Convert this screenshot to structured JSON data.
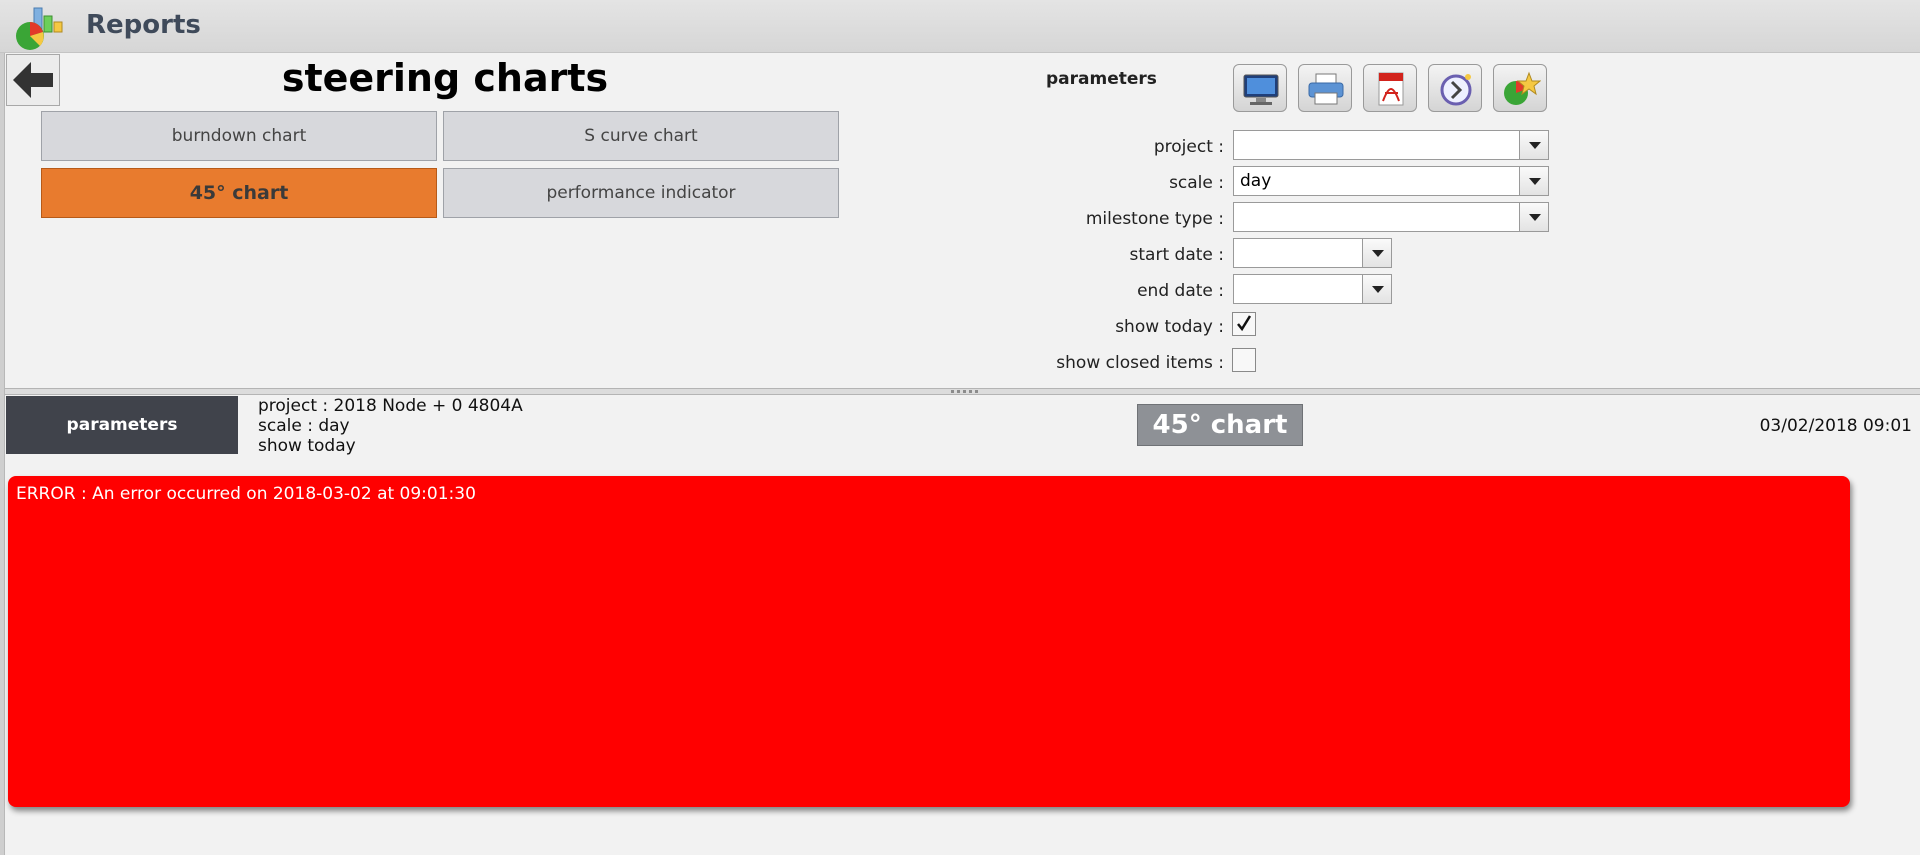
{
  "app": {
    "title": "Reports",
    "logo_icon": "reports-chart-icon"
  },
  "page": {
    "title": "steering charts",
    "back_icon": "back-arrow-icon"
  },
  "chart_buttons": [
    {
      "label": "burndown chart",
      "active": false
    },
    {
      "label": "S curve chart",
      "active": false
    },
    {
      "label": "45° chart",
      "active": true
    },
    {
      "label": "performance indicator",
      "active": false
    }
  ],
  "parameters": {
    "heading": "parameters",
    "toolbar": [
      {
        "name": "display-icon",
        "tooltip": "display"
      },
      {
        "name": "print-icon",
        "tooltip": "print"
      },
      {
        "name": "pdf-icon",
        "tooltip": "pdf"
      },
      {
        "name": "history-icon",
        "tooltip": "history"
      },
      {
        "name": "favorite-report-icon",
        "tooltip": "favorite"
      }
    ],
    "fields": {
      "project": {
        "label": "project :",
        "value": ""
      },
      "scale": {
        "label": "scale :",
        "value": "day"
      },
      "milestone_type": {
        "label": "milestone type :",
        "value": ""
      },
      "start_date": {
        "label": "start date :",
        "value": ""
      },
      "end_date": {
        "label": "end date :",
        "value": ""
      },
      "show_today": {
        "label": "show today :",
        "checked": true
      },
      "show_closed_items": {
        "label": "show closed items :",
        "checked": false
      }
    }
  },
  "result": {
    "parameters_label": "parameters",
    "summary": [
      "project : 2018 Node + 0 4804A",
      "scale : day",
      "show today"
    ],
    "chart_title": "45° chart",
    "timestamp": "03/02/2018 09:01",
    "error_message": "ERROR : An error occurred on 2018-03-02 at 09:01:30"
  },
  "colors": {
    "accent_active": "#e87b2e",
    "error_background": "#ff0000",
    "dark_panel": "#40434b"
  }
}
